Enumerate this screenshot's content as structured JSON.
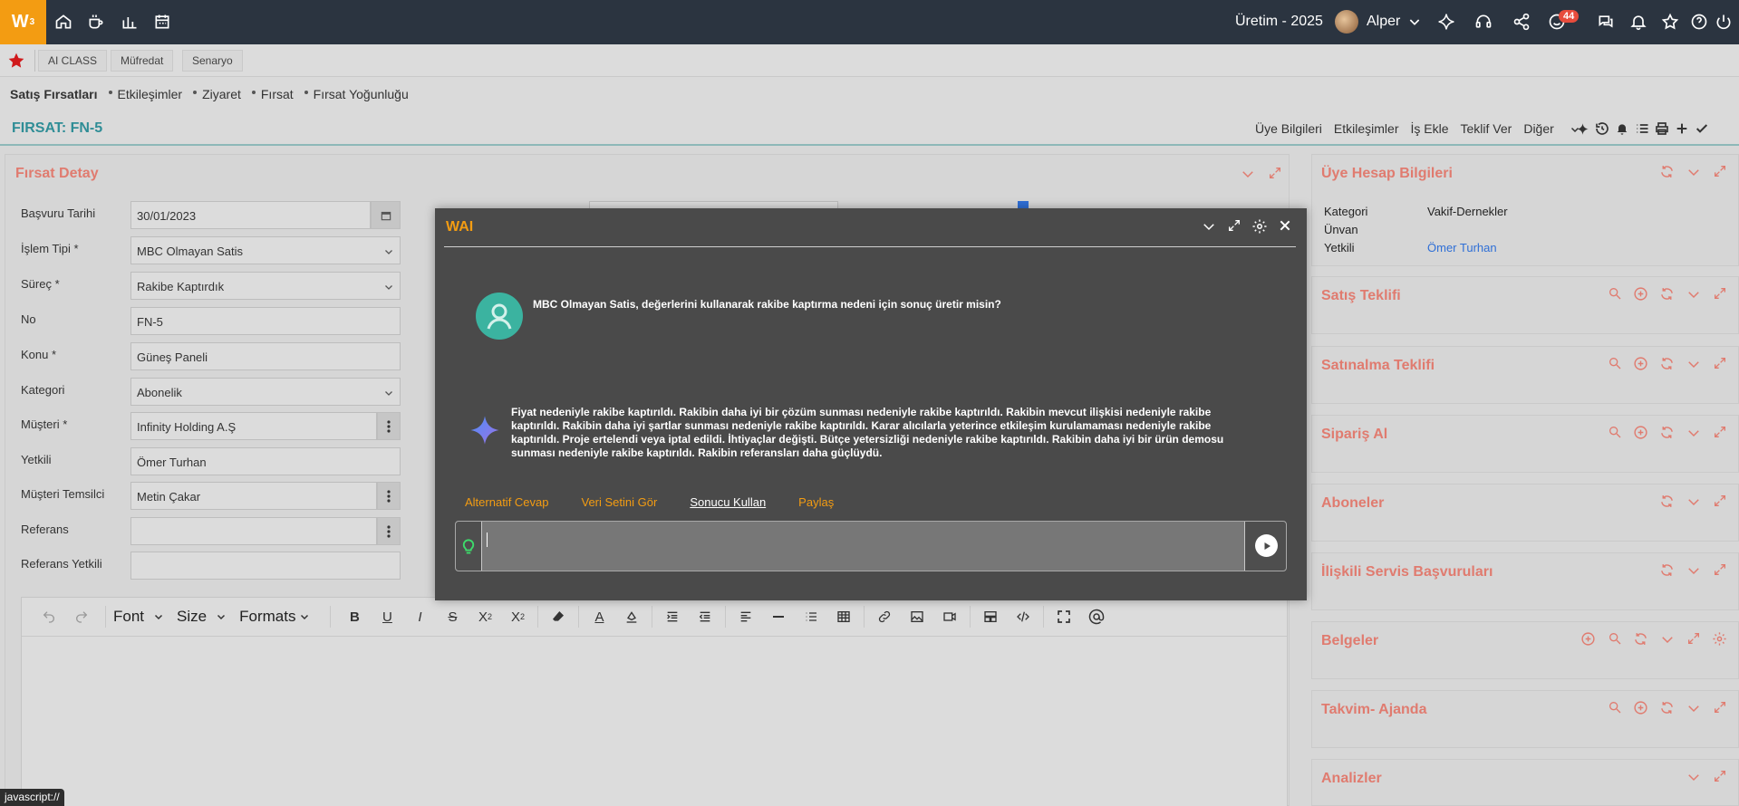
{
  "app": {
    "logo": "W",
    "logo_sup": "3",
    "period": "Üretim - 2025",
    "user_name": "Alper",
    "notification_count": "44"
  },
  "quickbar": {
    "tabs": [
      "AI CLASS",
      "Müfredat",
      "Senaryo"
    ]
  },
  "breadcrumbs": [
    "Satış Fırsatları",
    "Etkileşimler",
    "Ziyaret",
    "Fırsat",
    "Fırsat Yoğunluğu"
  ],
  "titlebar": {
    "title": "FIRSAT: FN-5",
    "links": [
      "Üye Bilgileri",
      "Etkileşimler",
      "İş Ekle",
      "Teklif Ver",
      "Diğer"
    ]
  },
  "detail": {
    "title": "Fırsat Detay",
    "fields": [
      {
        "label": "Başvuru Tarihi",
        "value": "30/01/2023"
      },
      {
        "label": "İşlem Tipi *",
        "value": "MBC Olmayan Satis"
      },
      {
        "label": "Süreç *",
        "value": "Rakibe Kaptırdık"
      },
      {
        "label": "No",
        "value": "FN-5"
      },
      {
        "label": "Konu *",
        "value": "Güneş Paneli"
      },
      {
        "label": "Kategori",
        "value": "Abonelik"
      },
      {
        "label": "Müşteri *",
        "value": "Infinity Holding A.Ş"
      },
      {
        "label": "Yetkili",
        "value": "Ömer Turhan"
      },
      {
        "label": "Müşteri Temsilci",
        "value": "Metin Çakar"
      },
      {
        "label": "Referans",
        "value": ""
      },
      {
        "label": "Referans Yetkili",
        "value": ""
      }
    ],
    "editor": {
      "font": "Font",
      "size": "Size",
      "formats": "Formats"
    }
  },
  "right": {
    "account": {
      "title": "Üye Hesap Bilgileri",
      "rows": [
        {
          "key": "Kategori",
          "value": "Vakif-Dernekler"
        },
        {
          "key": "Ünvan",
          "value": ""
        },
        {
          "key": "Yetkili",
          "value": "Ömer Turhan"
        }
      ]
    },
    "cards": [
      "Satış Teklifi",
      "Satınalma Teklifi",
      "Sipariş Al",
      "Aboneler",
      "İlişkili Servis Başvuruları",
      "Belgeler",
      "Takvim- Ajanda",
      "Analizler"
    ]
  },
  "modal": {
    "title": "WAI",
    "user_message": "MBC Olmayan Satis, değerlerini kullanarak rakibe kaptırma nedeni için sonuç üretir misin?",
    "ai_message": "Fiyat nedeniyle rakibe kaptırıldı. Rakibin daha iyi bir çözüm sunması nedeniyle rakibe kaptırıldı. Rakibin mevcut ilişkisi nedeniyle rakibe kaptırıldı. Rakibin daha iyi şartlar sunması nedeniyle rakibe kaptırıldı. Karar alıcılarla yeterince etkileşim kurulamaması nedeniyle rakibe kaptırıldı. Proje ertelendi veya iptal edildi. İhtiyaçlar değişti. Bütçe yetersizliği nedeniyle rakibe kaptırıldı. Rakibin daha iyi bir ürün demosu sunması nedeniyle rakibe kaptırıldı. Rakibin referansları daha güçlüydü.",
    "actions": [
      "Alternatif Cevap",
      "Veri Setini Gör",
      "Sonucu Kullan",
      "Paylaş"
    ],
    "input_value": ""
  },
  "status_bar": "javascript://",
  "colors": {
    "accent": "#f39c12",
    "title_teal": "#2f8d96",
    "card_title": "#e07b6f",
    "topbar": "#2b3440",
    "modal_bg": "#4a4a4a"
  }
}
